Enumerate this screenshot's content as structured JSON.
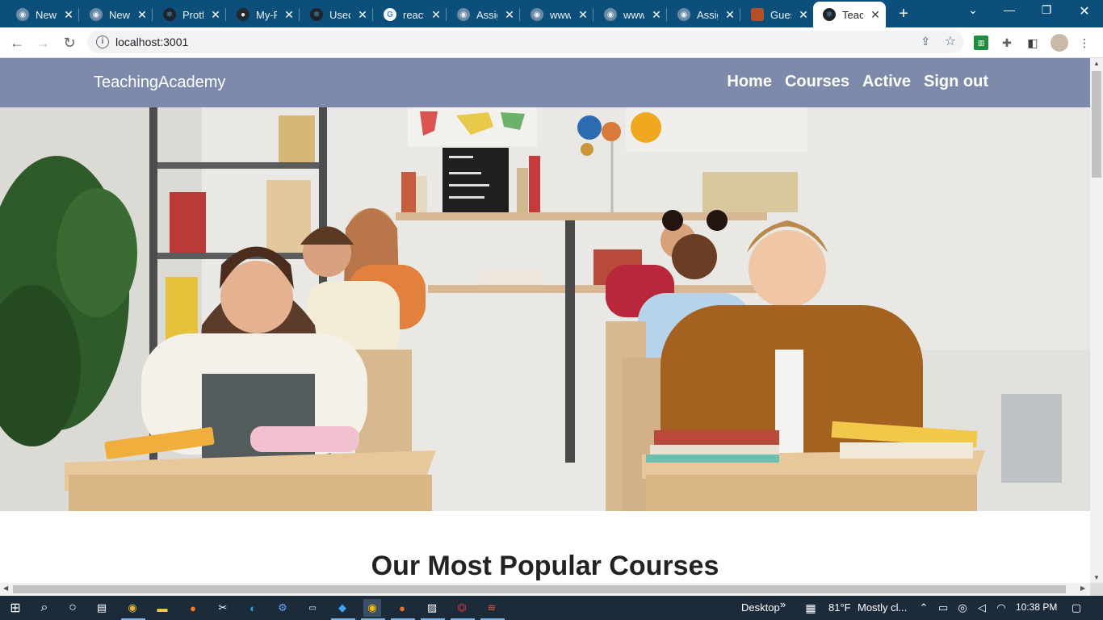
{
  "browser": {
    "tabs": [
      {
        "title": "New",
        "favicon": "globe-icon"
      },
      {
        "title": "New",
        "favicon": "globe-icon"
      },
      {
        "title": "Protf",
        "favicon": "react-icon"
      },
      {
        "title": "My-F",
        "favicon": "github-icon"
      },
      {
        "title": "Used",
        "favicon": "react-icon"
      },
      {
        "title": "react",
        "favicon": "google-icon"
      },
      {
        "title": "Assig",
        "favicon": "globe-icon"
      },
      {
        "title": "www",
        "favicon": "globe-icon"
      },
      {
        "title": "www",
        "favicon": "globe-icon"
      },
      {
        "title": "Assig",
        "favicon": "globe-icon"
      },
      {
        "title": "Gues",
        "favicon": "image-icon"
      },
      {
        "title": "Teacl",
        "favicon": "react-icon",
        "active": true
      }
    ],
    "new_tab": "+",
    "url": "localhost:3001"
  },
  "site": {
    "brand": "TeachingAcademy",
    "menu": [
      "Home",
      "Courses",
      "Active",
      "Sign out"
    ],
    "nav_color": "#7d8aac",
    "hero_alt": "classroom",
    "section_title": "Our Most Popular Courses"
  },
  "taskbar": {
    "desktop_label": "Desktop",
    "chevron": "»",
    "temperature": "81°F",
    "weather": "Mostly cl...",
    "time": "10:38 PM"
  }
}
